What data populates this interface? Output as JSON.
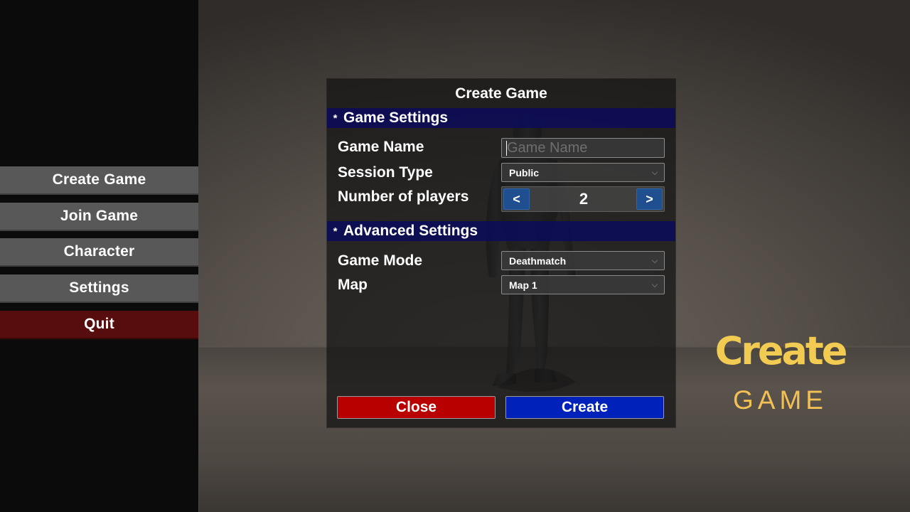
{
  "menu": {
    "items": [
      {
        "label": "Create Game"
      },
      {
        "label": "Join Game"
      },
      {
        "label": "Character"
      },
      {
        "label": "Settings"
      },
      {
        "label": "Quit"
      }
    ]
  },
  "dialog": {
    "title": "Create Game",
    "game_settings": {
      "header": "Game Settings",
      "game_name_label": "Game Name",
      "game_name_value": "",
      "game_name_placeholder": "Game Name",
      "session_type_label": "Session Type",
      "session_type_value": "Public",
      "players_label": "Number of players",
      "players_value": "2",
      "decrement_label": "<",
      "increment_label": ">"
    },
    "advanced_settings": {
      "header": "Advanced Settings",
      "game_mode_label": "Game Mode",
      "game_mode_value": "Deathmatch",
      "map_label": "Map",
      "map_value": "Map 1"
    },
    "close_label": "Close",
    "create_label": "Create"
  },
  "brand": {
    "title": "Create",
    "subtitle": "GAME"
  },
  "colors": {
    "section_header": "#0a0a5a",
    "close_button": "#b80000",
    "create_button": "#0022bb",
    "stepper_button": "#1f4f8f",
    "quit_button": "#570d0d",
    "brand": "#f2cc52"
  },
  "icons": {
    "section_marker": "asterisk-icon",
    "dropdown": "chevron-down-icon"
  }
}
